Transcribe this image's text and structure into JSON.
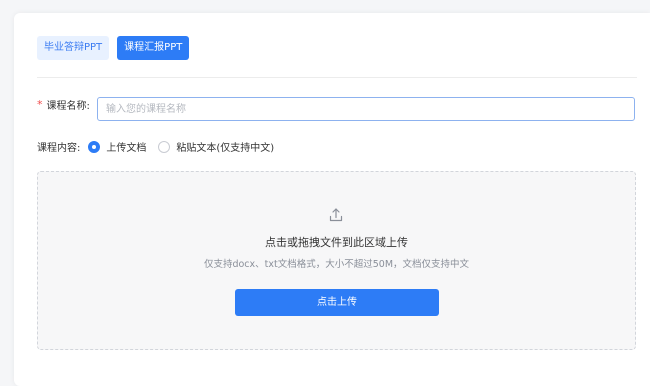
{
  "tabs": [
    {
      "label": "毕业答辩PPT",
      "active": false
    },
    {
      "label": "课程汇报PPT",
      "active": true
    }
  ],
  "form": {
    "course_name": {
      "required_mark": "*",
      "label": "课程名称:",
      "value": "",
      "placeholder": "输入您的课程名称"
    },
    "course_content": {
      "label": "课程内容:",
      "options": [
        {
          "label": "上传文档",
          "checked": true
        },
        {
          "label": "粘贴文本(仅支持中文)",
          "checked": false
        }
      ]
    }
  },
  "upload": {
    "icon": "upload-icon",
    "title": "点击或拖拽文件到此区域上传",
    "hint": "仅支持docx、txt文档格式，大小不超过50M，文档仅支持中文",
    "button_label": "点击上传"
  },
  "colors": {
    "primary": "#2d7cf6",
    "required": "#f04b4b",
    "tab_inactive_bg": "#e8f1ff"
  }
}
